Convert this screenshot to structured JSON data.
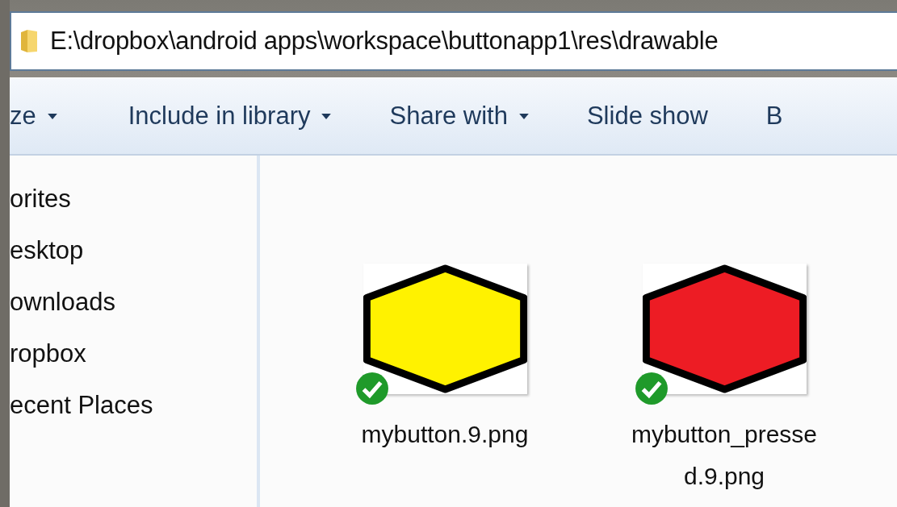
{
  "address_bar": {
    "path": "E:\\dropbox\\android apps\\workspace\\buttonapp1\\res\\drawable"
  },
  "toolbar": [
    {
      "label": "ze",
      "dropdown": true
    },
    {
      "label": "Include in library",
      "dropdown": true
    },
    {
      "label": "Share with",
      "dropdown": true
    },
    {
      "label": "Slide show",
      "dropdown": false
    },
    {
      "label": "B",
      "dropdown": false
    }
  ],
  "sidebar": {
    "items": [
      "orites",
      "esktop",
      "ownloads",
      "ropbox",
      "ecent Places"
    ]
  },
  "files": [
    {
      "name": "mybutton.9.png",
      "color": "#fff200",
      "synced": true
    },
    {
      "name": "mybutton_pressed.9.png",
      "color": "#ed1c24",
      "synced": true
    }
  ]
}
